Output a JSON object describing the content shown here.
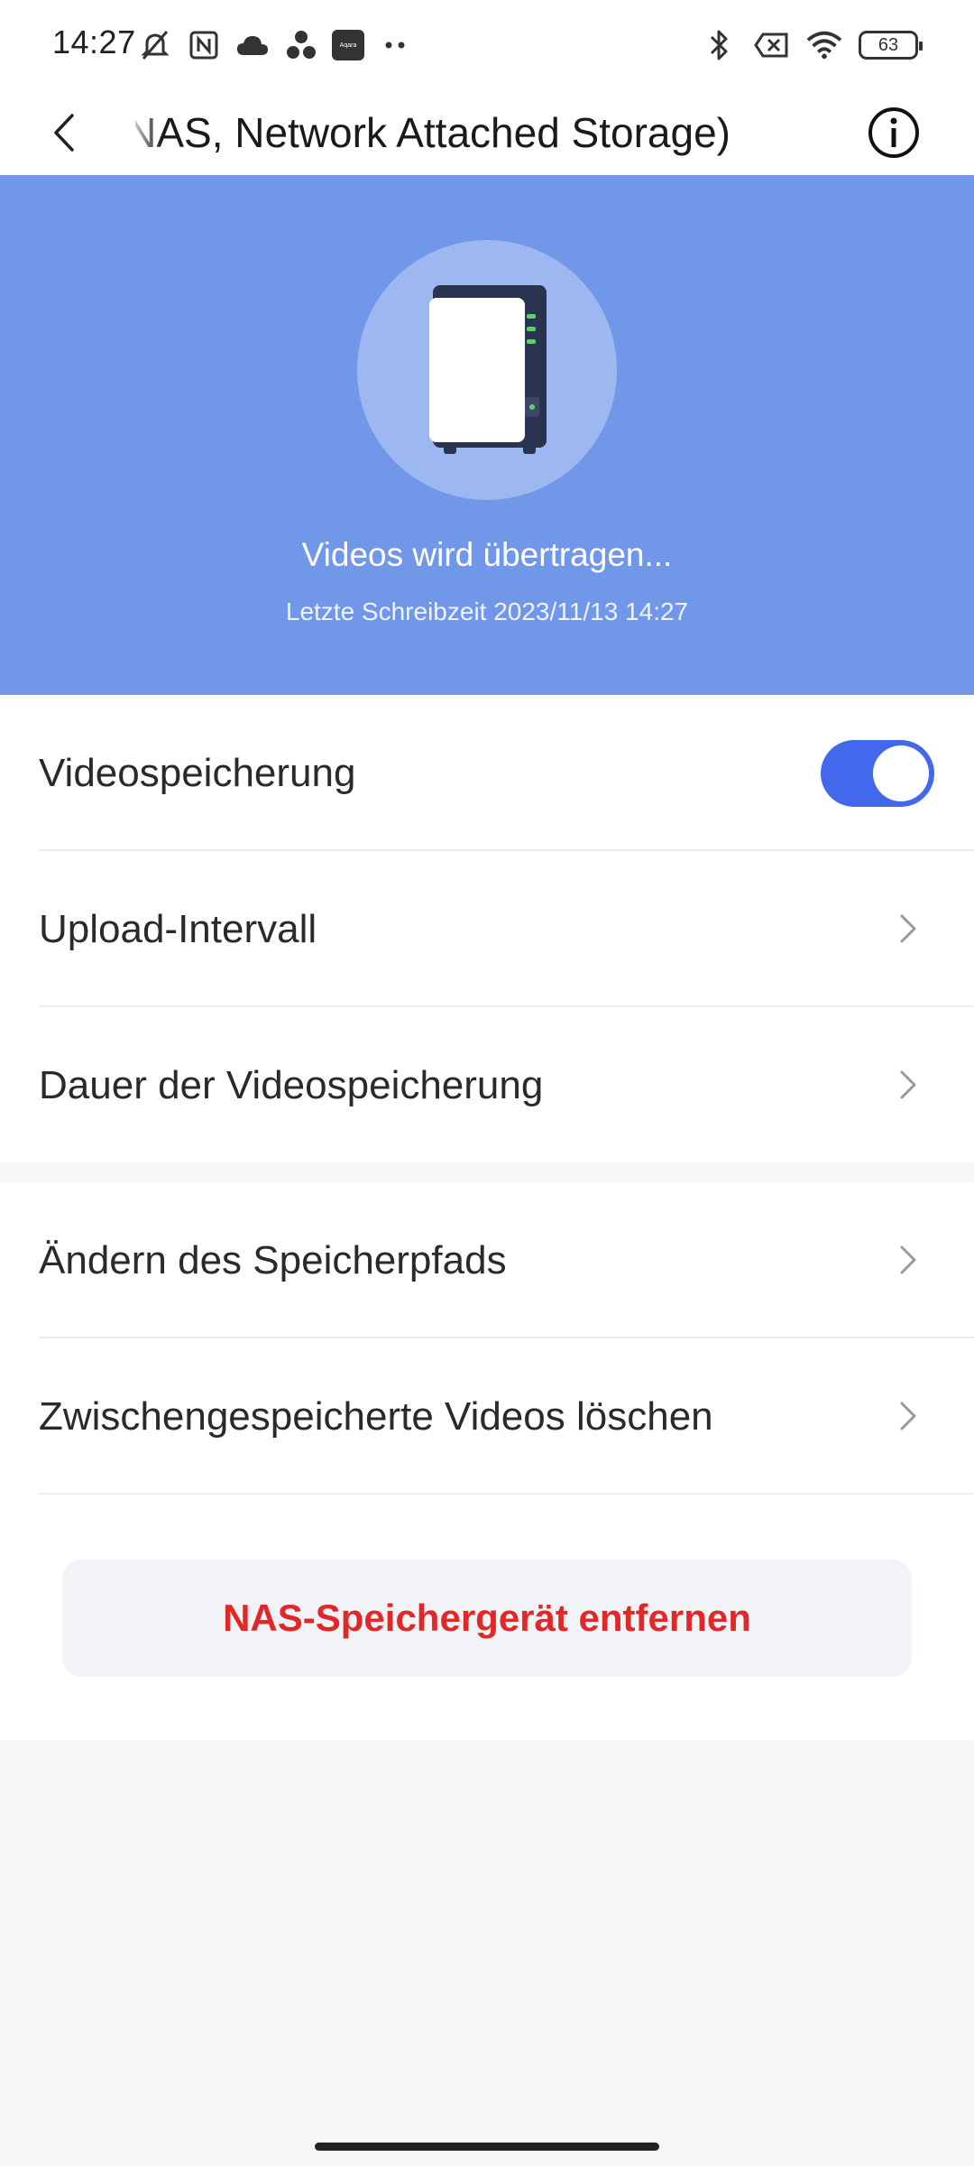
{
  "status_bar": {
    "time": "14:27",
    "battery": "63",
    "aqara_label": "Aqara",
    "left_icons": [
      "mute-icon",
      "nfc-icon",
      "cloud-icon",
      "dots-cluster-icon",
      "aqara-app-icon",
      "more-dots-icon"
    ],
    "right_icons": [
      "bluetooth-icon",
      "no-sim-icon",
      "wifi-icon",
      "battery-icon"
    ]
  },
  "header": {
    "title": "(NAS, Network Attached Storage)"
  },
  "hero": {
    "status_text": "Videos wird übertragen...",
    "last_write": "Letzte Schreibzeit 2023/11/13 14:27",
    "background_color": "#7097e8"
  },
  "settings": {
    "video_storage_label": "Videospeicherung",
    "video_storage_enabled": true,
    "upload_interval_label": "Upload-Intervall",
    "storage_duration_label": "Dauer der Videospeicherung",
    "change_path_label": "Ändern des Speicherpfads",
    "clear_cache_label": "Zwischengespeicherte Videos löschen"
  },
  "actions": {
    "remove_label": "NAS-Speichergerät entfernen",
    "remove_color": "#e02828"
  },
  "accent_color": "#4468ec"
}
